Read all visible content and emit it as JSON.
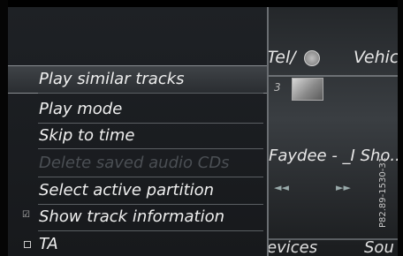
{
  "background": {
    "tab_tel": "Tel/",
    "tab_vehicle": "Vehic",
    "track_number": "3",
    "track_title": "Faydee - _I Sho..",
    "rewind_icon": "rewind-icon",
    "fast_forward_icon": "fast-forward-icon",
    "devices_label": "evices",
    "sound_label": "Sou",
    "image_code": "P82.89-1530-31"
  },
  "menu": {
    "items": [
      {
        "label": "Play similar tracks",
        "state": "selected"
      },
      {
        "label": "Play mode",
        "state": "normal"
      },
      {
        "label": "Skip to time",
        "state": "normal"
      },
      {
        "label": "Delete saved audio CDs",
        "state": "disabled"
      },
      {
        "label": "Select active partition",
        "state": "normal"
      },
      {
        "label": "Show track information",
        "state": "checked"
      },
      {
        "label": "TA",
        "state": "unchecked"
      }
    ],
    "check_icon": "checkmark-icon",
    "box_icon": "checkbox-icon"
  }
}
